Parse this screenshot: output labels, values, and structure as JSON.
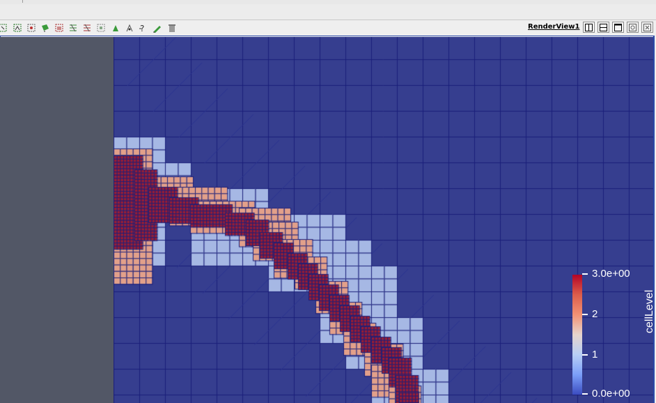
{
  "view": {
    "title": "RenderView1"
  },
  "toolbar": {
    "icons": [
      "select-cells-on-icon",
      "select-points-on-icon",
      "select-cells-through-icon",
      "select-points-through-icon",
      "select-block-icon",
      "interactive-select-cells-icon",
      "interactive-select-points-icon",
      "grow-selection-icon",
      "find-data-icon",
      "hover-points-icon",
      "hover-cells-icon",
      "query-help-icon",
      "edit-selection-icon",
      "clear-selection-icon"
    ]
  },
  "view_buttons": [
    "split-horizontal-icon",
    "split-vertical-icon",
    "maximize-icon",
    "restore-icon",
    "close-icon"
  ],
  "scalar_bar": {
    "title": "cellLevel",
    "max_label": "3.0e+00",
    "mid2_label": "2",
    "mid1_label": "1",
    "min_label": "0.0e+00",
    "range": [
      0,
      3
    ],
    "colormap": [
      "#3b4cc0",
      "#b8cff5",
      "#f29174",
      "#b40426"
    ]
  },
  "colors": {
    "background": "#363e8f",
    "level0": "#363e8f",
    "level1": "#a6b8e4",
    "level2": "#e2a08a",
    "level3": "#9a1d33",
    "mesh_line": "#1a1f7a",
    "left_panel": "#525766"
  }
}
